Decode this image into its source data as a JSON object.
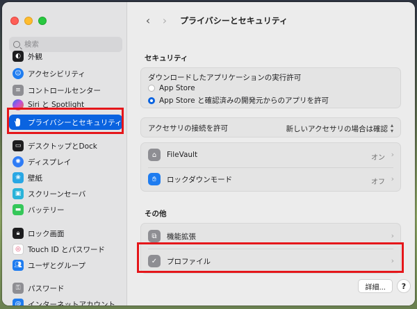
{
  "sidebar": {
    "search_placeholder": "検索",
    "items": [
      {
        "label": "外観",
        "icon": "appearance-icon",
        "color": "#1d1d1f"
      },
      {
        "label": "アクセシビリティ",
        "icon": "accessibility-icon",
        "color": "#1e7cf0"
      },
      {
        "label": "コントロールセンター",
        "icon": "control-center-icon",
        "color": "#8e8e93"
      },
      {
        "label": "Siri と Spotlight",
        "icon": "siri-icon",
        "color": "#c24fd9"
      },
      {
        "label": "プライバシーとセキュリティ",
        "icon": "privacy-hand-icon",
        "color": "#1e7cf0"
      },
      {
        "label": "デスクトップとDock",
        "icon": "desktop-dock-icon",
        "color": "#1d1d1f"
      },
      {
        "label": "ディスプレイ",
        "icon": "display-icon",
        "color": "#2f7cf6"
      },
      {
        "label": "壁紙",
        "icon": "wallpaper-icon",
        "color": "#29a7e4"
      },
      {
        "label": "スクリーンセーバ",
        "icon": "screensaver-icon",
        "color": "#29b3d9"
      },
      {
        "label": "バッテリー",
        "icon": "battery-icon",
        "color": "#35c759"
      },
      {
        "label": "ロック画面",
        "icon": "lock-screen-icon",
        "color": "#1d1d1f"
      },
      {
        "label": "Touch ID とパスワード",
        "icon": "touch-id-icon",
        "color": "#ffffff"
      },
      {
        "label": "ユーザとグループ",
        "icon": "users-icon",
        "color": "#1e7cf0"
      },
      {
        "label": "パスワード",
        "icon": "key-icon",
        "color": "#8e8e93"
      },
      {
        "label": "インターネットアカウント",
        "icon": "internet-accounts-icon",
        "color": "#1e7cf0"
      }
    ],
    "selected_index": 4
  },
  "toolbar": {
    "title": "プライバシーとセキュリティ",
    "back": "‹",
    "forward": "›"
  },
  "security": {
    "heading": "セキュリティ",
    "download_label": "ダウンロードしたアプリケーションの実行許可",
    "option_app_store": "App Store",
    "option_app_store_dev": "App Store と確認済みの開発元からのアプリを許可",
    "selected_option": "App Store と確認済みの開発元からのアプリを許可",
    "accessory_label": "アクセサリの接続を許可",
    "accessory_value": "新しいアクセサリの場合は確認",
    "filevault_label": "FileVault",
    "filevault_value": "オン",
    "lockdown_label": "ロックダウンモード",
    "lockdown_value": "オフ"
  },
  "other": {
    "heading": "その他",
    "extensions_label": "機能拡張",
    "profiles_label": "プロファイル"
  },
  "footer": {
    "details_label": "詳細...",
    "help_label": "?"
  },
  "colors": {
    "accent": "#0a63e0",
    "highlight_box": "#e5161a"
  }
}
